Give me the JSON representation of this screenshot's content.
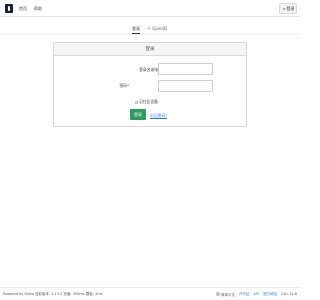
{
  "nav": {
    "home": "首页",
    "help": "帮助",
    "login_label": "登录"
  },
  "tabs": {
    "login": "登录",
    "openid": "OpenID"
  },
  "form": {
    "title": "登录",
    "user_label": "登录名或电子邮箱地址",
    "user_required": "*",
    "user_value": "",
    "password_label": "密码",
    "password_required": "*",
    "password_value": "",
    "remember_label": "记住此设备",
    "submit_label": "登录",
    "forgot_label": "忘记密码?"
  },
  "footer": {
    "powered": "Powered by Gitea 当前版本: 1.13.2 页面: 300ms 模板: 3ms",
    "language": "简体中文",
    "license": "许可证",
    "api": "API",
    "website": "官方网站",
    "go_version": "Go1.15.8"
  },
  "colors": {
    "brand_dark": "#1a2233",
    "submit_green": "#2f9e5a",
    "link_blue": "#2b7bd6"
  }
}
